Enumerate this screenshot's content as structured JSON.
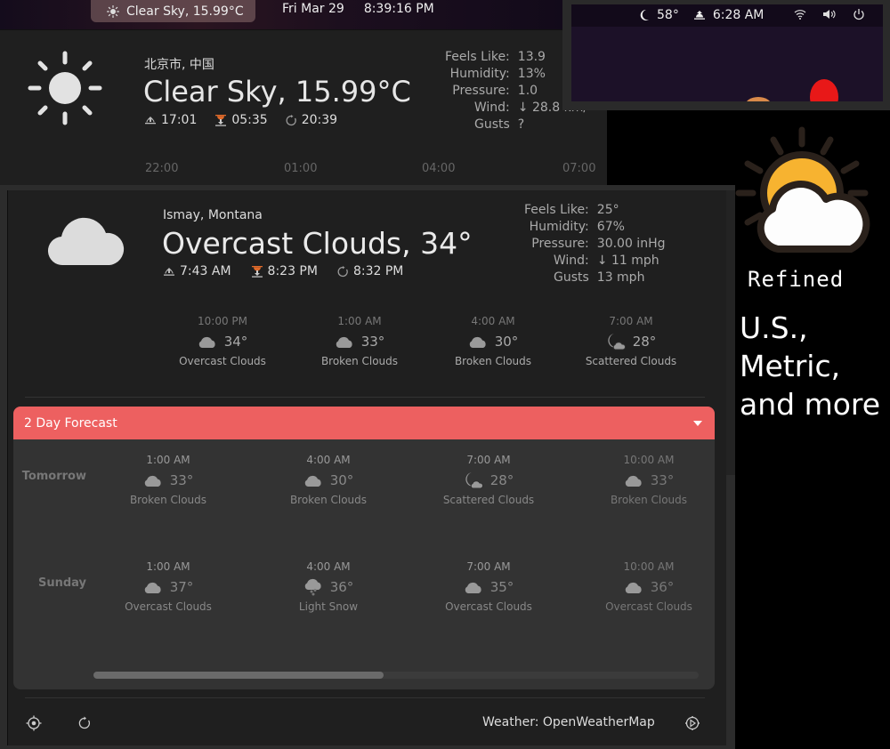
{
  "topbar": {
    "weather_icon": "sun-icon",
    "weather_label": "Clear Sky, 15.99°C",
    "date": "Fri Mar 29",
    "time": "8:39:16 PM"
  },
  "thumbnail": {
    "moon_icon": "moon-icon",
    "temp": "58°",
    "sunrise_icon": "sunrise-icon",
    "sunrise": "6:28 AM",
    "wifi_icon": "wifi-icon",
    "volume_icon": "volume-icon",
    "power_icon": "power-icon"
  },
  "back_popup": {
    "location": "北京市, 中国",
    "condition": "Clear Sky, 15.99°C",
    "icon": "clear-sky-icon",
    "sunrise": "17:01",
    "sunset": "05:35",
    "updated": "20:39",
    "details": [
      {
        "label": "Feels Like:",
        "value": "13.9"
      },
      {
        "label": "Humidity:",
        "value": "13%"
      },
      {
        "label": "Pressure:",
        "value": "1.0"
      },
      {
        "label": "Wind:",
        "value": "↓ 28.8 km/"
      },
      {
        "label": "Gusts",
        "value": "?"
      }
    ],
    "hours": [
      "22:00",
      "01:00",
      "04:00",
      "07:00"
    ]
  },
  "main_popup": {
    "location": "Ismay, Montana",
    "condition": "Overcast Clouds, 34°",
    "icon": "overcast-clouds-icon",
    "sunrise": "7:43 AM",
    "sunset": "8:23 PM",
    "updated": "8:32 PM",
    "details": [
      {
        "label": "Feels Like:",
        "value": "25°"
      },
      {
        "label": "Humidity:",
        "value": "67%"
      },
      {
        "label": "Pressure:",
        "value": "30.00 inHg"
      },
      {
        "label": "Wind:",
        "value": "↓ 11 mph"
      },
      {
        "label": "Gusts",
        "value": "13 mph"
      }
    ],
    "hourly": [
      {
        "time": "10:00 PM",
        "icon": "cloud",
        "temp": "34°",
        "desc": "Overcast Clouds"
      },
      {
        "time": "1:00 AM",
        "icon": "cloud",
        "temp": "33°",
        "desc": "Broken Clouds"
      },
      {
        "time": "4:00 AM",
        "icon": "cloud",
        "temp": "30°",
        "desc": "Broken Clouds"
      },
      {
        "time": "7:00 AM",
        "icon": "moon-cloud",
        "temp": "28°",
        "desc": "Scattered Clouds"
      }
    ],
    "forecast": {
      "title": "2 Day Forecast",
      "scroll_position_fraction": 0.48,
      "days": [
        {
          "name": "Tomorrow",
          "slots": [
            {
              "time": "1:00 AM",
              "icon": "cloud",
              "temp": "33°",
              "desc": "Broken Clouds"
            },
            {
              "time": "4:00 AM",
              "icon": "cloud",
              "temp": "30°",
              "desc": "Broken Clouds"
            },
            {
              "time": "7:00 AM",
              "icon": "moon-cloud",
              "temp": "28°",
              "desc": "Scattered Clouds"
            },
            {
              "time": "10:00 AM",
              "icon": "cloud",
              "temp": "33°",
              "desc": "Broken Clouds"
            }
          ]
        },
        {
          "name": "Sunday",
          "slots": [
            {
              "time": "1:00 AM",
              "icon": "cloud",
              "temp": "37°",
              "desc": "Overcast Clouds"
            },
            {
              "time": "4:00 AM",
              "icon": "snow-cloud",
              "temp": "36°",
              "desc": "Light Snow"
            },
            {
              "time": "7:00 AM",
              "icon": "cloud",
              "temp": "35°",
              "desc": "Overcast Clouds"
            },
            {
              "time": "10:00 AM",
              "icon": "cloud",
              "temp": "36°",
              "desc": "Overcast Clouds"
            }
          ]
        }
      ]
    },
    "footer": {
      "locate_icon": "locate-icon",
      "refresh_icon": "refresh-icon",
      "provider": "Weather: OpenWeatherMap",
      "settings_icon": "settings-icon"
    }
  },
  "promo": {
    "icon": "partly-cloudy-icon",
    "title": "Refined",
    "units_line1": "U.S.,",
    "units_line2": "Metric,",
    "units_line3": "and more"
  },
  "colors": {
    "accent": "#ed6060",
    "panel_bg": "#1f1f1f",
    "forecast_bg": "#333333",
    "sun_yellow": "#f7b330"
  }
}
